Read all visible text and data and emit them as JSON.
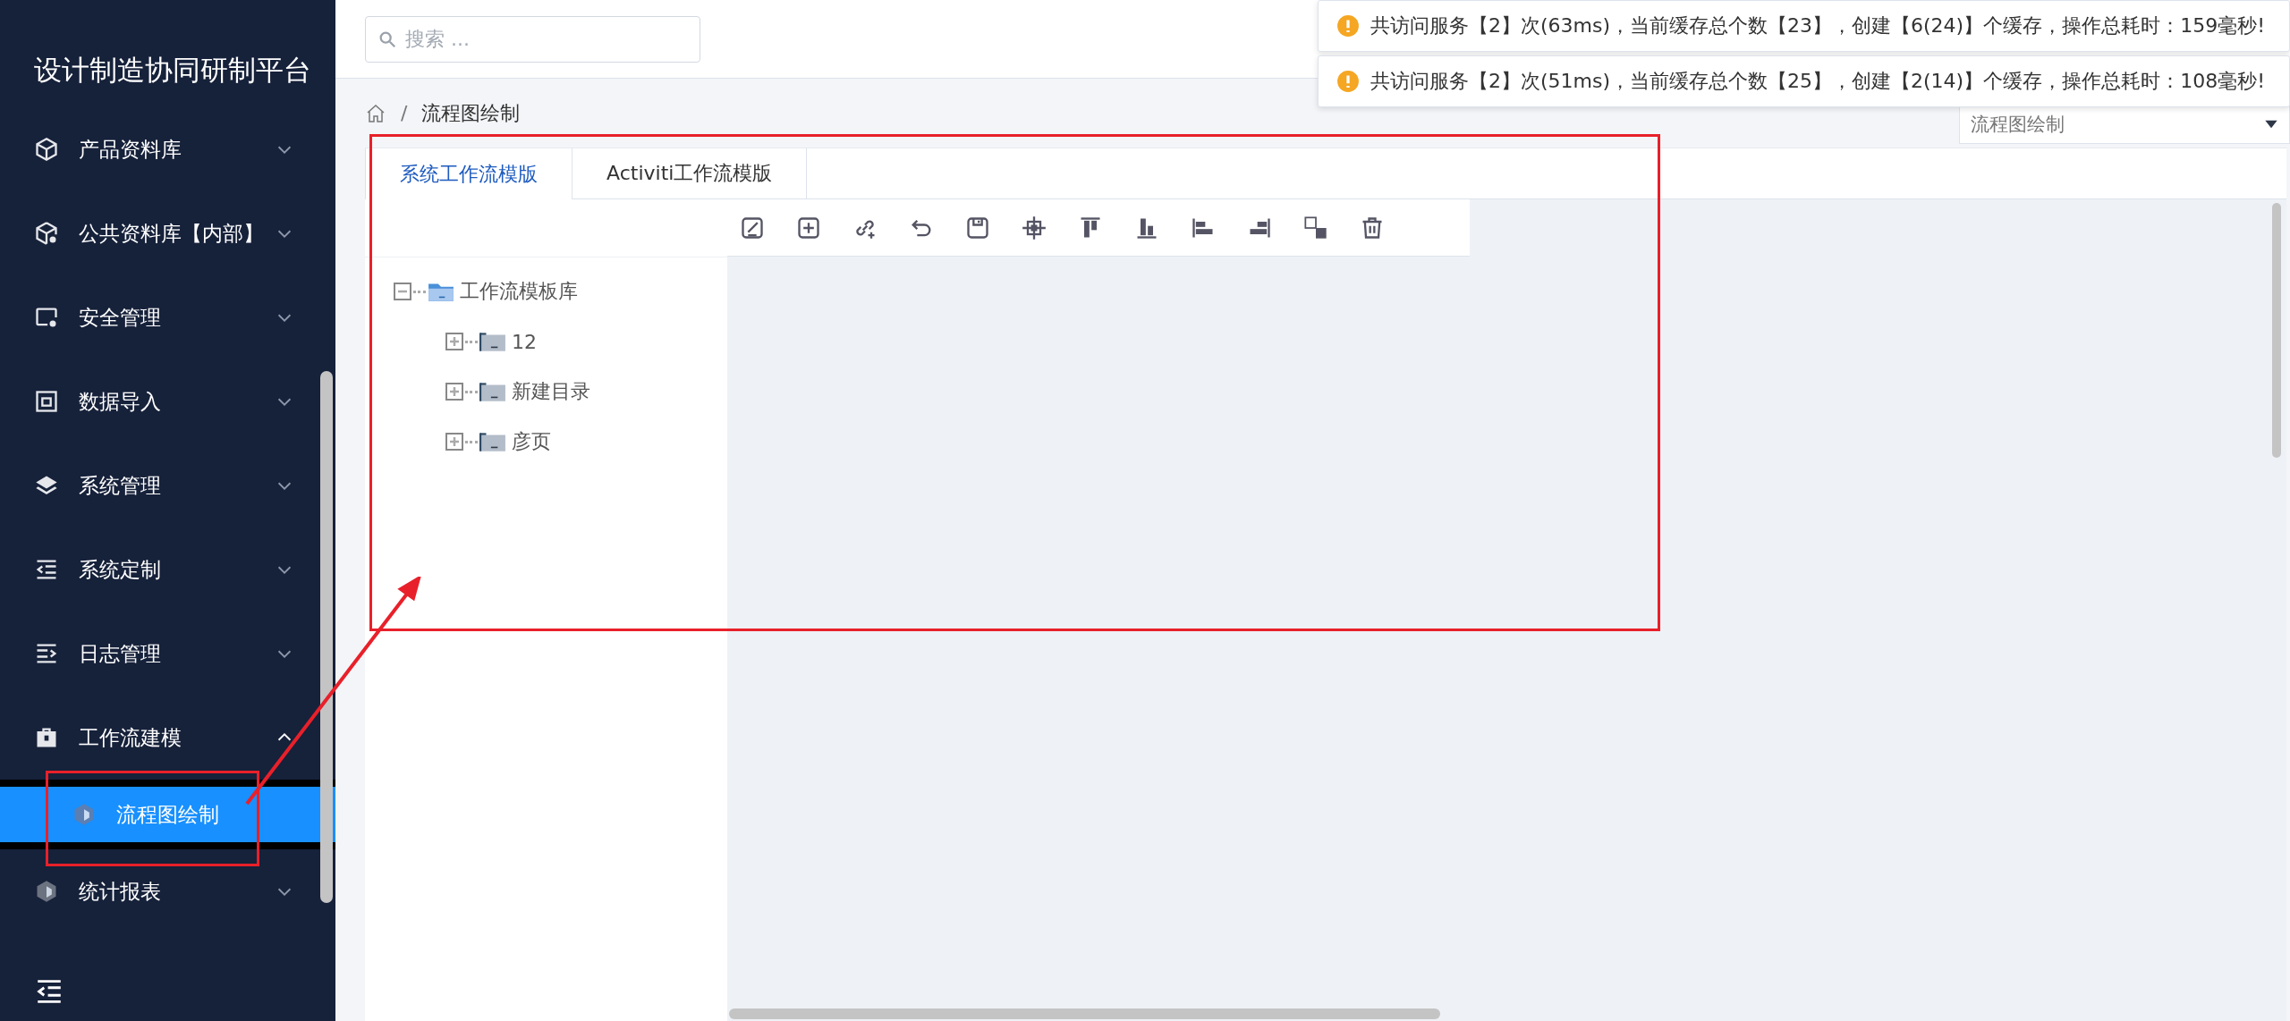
{
  "sidebar": {
    "title": "设计制造协同研制平台",
    "items": [
      {
        "label": "产品资料库",
        "expanded": false
      },
      {
        "label": "公共资料库【内部】",
        "expanded": false
      },
      {
        "label": "安全管理",
        "expanded": false
      },
      {
        "label": "数据导入",
        "expanded": false
      },
      {
        "label": "系统管理",
        "expanded": false
      },
      {
        "label": "系统定制",
        "expanded": false
      },
      {
        "label": "日志管理",
        "expanded": false
      },
      {
        "label": "工作流建模",
        "expanded": true,
        "children": [
          {
            "label": "流程图绘制",
            "selected": true
          }
        ]
      },
      {
        "label": "统计报表",
        "expanded": false
      }
    ]
  },
  "search": {
    "placeholder": "搜索 ..."
  },
  "notifications": [
    {
      "text": "共访问服务【2】次(63ms)，当前缓存总个数【23】，创建【6(24)】个缓存，操作总耗时：159毫秒!"
    },
    {
      "text": "共访问服务【2】次(51ms)，当前缓存总个数【25】，创建【2(14)】个缓存，操作总耗时：108毫秒!"
    }
  ],
  "breadcrumb": {
    "separator": "/",
    "current": "流程图绘制"
  },
  "page_select": {
    "value": "流程图绘制"
  },
  "tabs": [
    {
      "label": "系统工作流模版",
      "selected": true
    },
    {
      "label": "Activiti工作流模版",
      "selected": false
    }
  ],
  "tree": [
    {
      "label": "工作流模板库",
      "expanded": true,
      "children": [
        {
          "label": "12",
          "expanded": false
        },
        {
          "label": "新建目录",
          "expanded": false
        },
        {
          "label": "彦页",
          "expanded": false
        }
      ]
    }
  ]
}
